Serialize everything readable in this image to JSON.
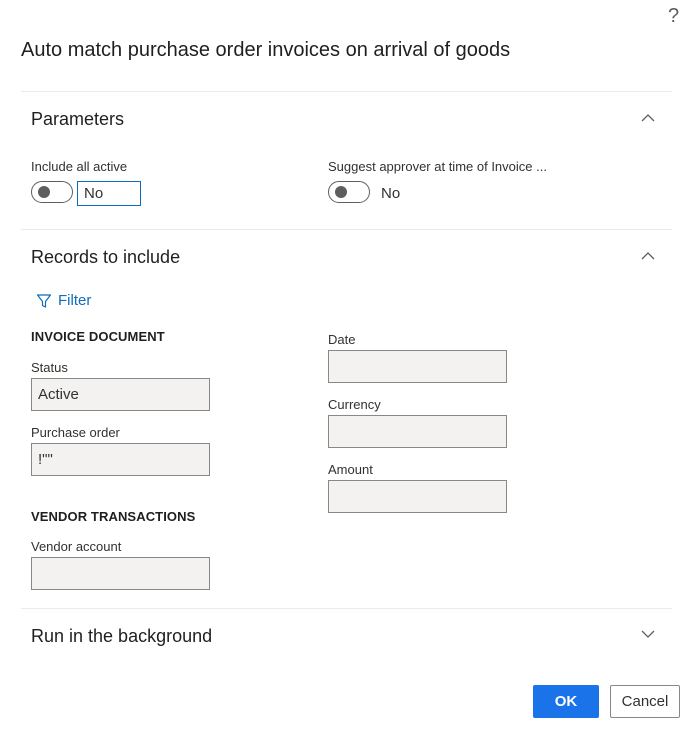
{
  "help_label": "?",
  "dialog": {
    "title": "Auto match purchase order invoices on arrival of goods"
  },
  "parameters": {
    "title": "Parameters",
    "include_all_active": {
      "label": "Include all active",
      "value": "No"
    },
    "suggest_approver": {
      "label": "Suggest approver at time of Invoice ...",
      "value": "No"
    }
  },
  "records": {
    "title": "Records to include",
    "filter_label": "Filter",
    "invoice_document": {
      "heading": "INVOICE DOCUMENT",
      "status": {
        "label": "Status",
        "value": "Active"
      },
      "purchase_order": {
        "label": "Purchase order",
        "value": "!\"\""
      }
    },
    "date": {
      "label": "Date",
      "value": ""
    },
    "currency": {
      "label": "Currency",
      "value": ""
    },
    "amount": {
      "label": "Amount",
      "value": ""
    },
    "vendor_transactions": {
      "heading": "VENDOR TRANSACTIONS",
      "vendor_account": {
        "label": "Vendor account",
        "value": ""
      }
    }
  },
  "background": {
    "title": "Run in the background"
  },
  "footer": {
    "ok_label": "OK",
    "cancel_label": "Cancel"
  },
  "colors": {
    "accent": "#1a73e8",
    "link": "#0f6cbd",
    "input_bg": "#f3f2f1"
  }
}
